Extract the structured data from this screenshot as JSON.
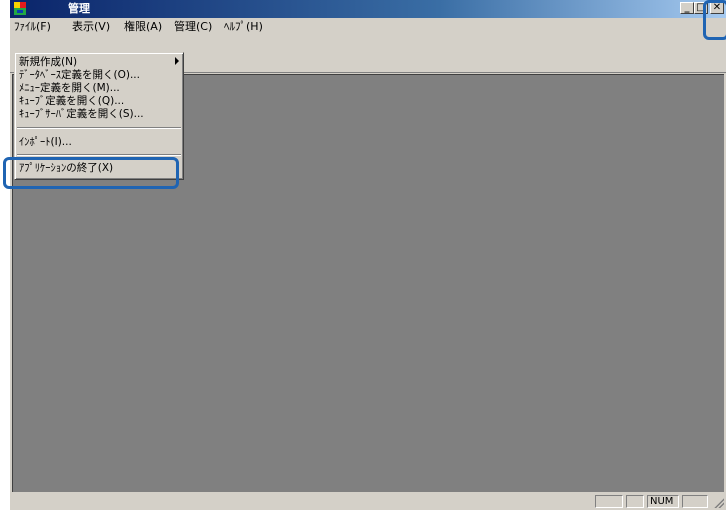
{
  "window": {
    "title": "管理"
  },
  "caption_buttons": {
    "minimize": "_",
    "maximize": "□",
    "close": "✕"
  },
  "menubar": {
    "file": "ﾌｧｲﾙ(F)",
    "view": "表示(V)",
    "authority": "権限(A)",
    "admin": "管理(C)",
    "help": "ﾍﾙﾌﾟ(H)"
  },
  "file_menu": {
    "items": [
      {
        "label": "新規作成(N)",
        "has_submenu": true
      },
      {
        "label": "ﾃﾞｰﾀﾍﾞｰｽ定義を開く(O)..."
      },
      {
        "label": "ﾒﾆｭｰ定義を開く(M)..."
      },
      {
        "label": "ｷｭｰﾌﾞ定義を開く(Q)..."
      },
      {
        "label": "ｷｭｰﾌﾞｻｰﾊﾞ定義を開く(S)..."
      },
      {
        "label": "ｲﾝﾎﾟｰﾄ(I)..."
      },
      {
        "label": "ｱﾌﾟﾘｹｰｼｮﾝの終了(X)"
      }
    ]
  },
  "statusbar": {
    "pane_num": "NUM"
  },
  "colors": {
    "highlight": "#1f64b3",
    "workspace": "#808080",
    "titlebar": "#0a246a"
  }
}
